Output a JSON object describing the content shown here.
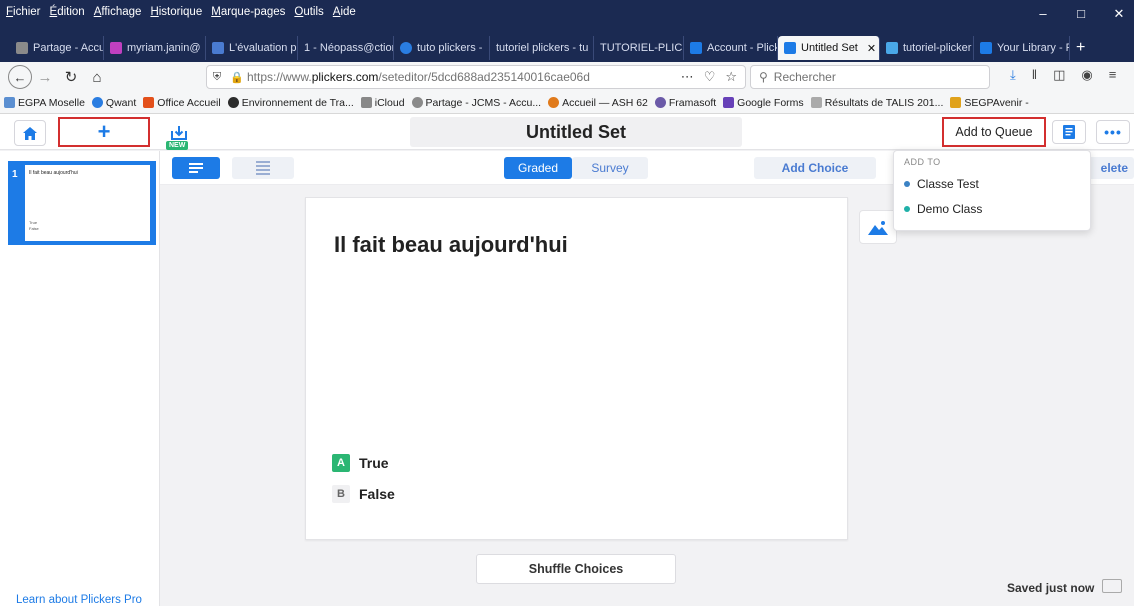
{
  "browser": {
    "menu": [
      "Fichier",
      "Édition",
      "Affichage",
      "Historique",
      "Marque-pages",
      "Outils",
      "Aide"
    ],
    "tabs": [
      {
        "label": "Partage - Accu",
        "color": "#8a8a8a"
      },
      {
        "label": "myriam.janin@",
        "color": "#c040c0"
      },
      {
        "label": "L'évaluation pa",
        "color": "#4a7bd1"
      },
      {
        "label": "1 - Néopass@ction",
        "color": ""
      },
      {
        "label": "tuto plickers -",
        "color": "#2a7de1"
      },
      {
        "label": "tutoriel plickers - tu",
        "color": ""
      },
      {
        "label": "TUTORIEL-PLICKER",
        "color": ""
      },
      {
        "label": "Account - Plick",
        "color": "#1d7be6"
      },
      {
        "label": "Untitled Set",
        "color": "#1d7be6",
        "active": true
      },
      {
        "label": "tutoriel-plicker",
        "color": "#4aa8e8"
      },
      {
        "label": "Your Library - P",
        "color": "#1d7be6"
      }
    ],
    "close_glyph": "✕",
    "new_tab_glyph": "+",
    "url_prefix": "https://www.",
    "url_host": "plickers.com",
    "url_path": "/seteditor/5dcd688ad235140016cae06d",
    "search_placeholder": "Rechercher",
    "bookmarks": [
      {
        "label": "EGPA Moselle",
        "color": "#5b8fd1"
      },
      {
        "label": "Qwant",
        "color": "#2a7de1"
      },
      {
        "label": "Office Accueil",
        "color": "#e3501b"
      },
      {
        "label": "Environnement de Tra...",
        "color": "#2c2c2c"
      },
      {
        "label": "iCloud",
        "color": "#888888"
      },
      {
        "label": "Partage - JCMS - Accu...",
        "color": "#8a8a8a"
      },
      {
        "label": "Accueil — ASH 62",
        "color": "#e07a1b"
      },
      {
        "label": "Framasoft",
        "color": "#6b5aa8"
      },
      {
        "label": "Google Forms",
        "color": "#6741b8"
      },
      {
        "label": "Résultats de TALIS 201...",
        "color": "#aaaaaa"
      },
      {
        "label": "SEGPAvenir -",
        "color": "#e0a21b"
      }
    ]
  },
  "app": {
    "set_title": "Untitled Set",
    "add_to_queue": "Add to Queue",
    "new_badge": "NEW",
    "more_glyph": "•••",
    "plus_glyph": "+",
    "sidebar": {
      "slides": [
        {
          "num": "1",
          "question": "Il fait beau aujourd'hui",
          "choices": [
            "True",
            "False"
          ]
        }
      ],
      "learn_link": "Learn about Plickers Pro"
    },
    "toolbar": {
      "graded": "Graded",
      "survey": "Survey",
      "add_choice": "Add Choice",
      "delete": "elete"
    },
    "queue_menu": {
      "header": "ADD TO",
      "items": [
        {
          "label": "Classe Test",
          "color": "#3b82c4"
        },
        {
          "label": "Demo Class",
          "color": "#1fb0a8"
        }
      ]
    },
    "slide": {
      "question": "Il fait beau aujourd'hui",
      "choices": [
        {
          "letter": "A",
          "text": "True",
          "correct": true
        },
        {
          "letter": "B",
          "text": "False",
          "correct": false
        }
      ]
    },
    "shuffle": "Shuffle Choices",
    "save_status": "Saved just now",
    "colors": {
      "accent": "#1d7be6",
      "correct": "#2bb673",
      "highlight": "#d32f2f"
    }
  }
}
